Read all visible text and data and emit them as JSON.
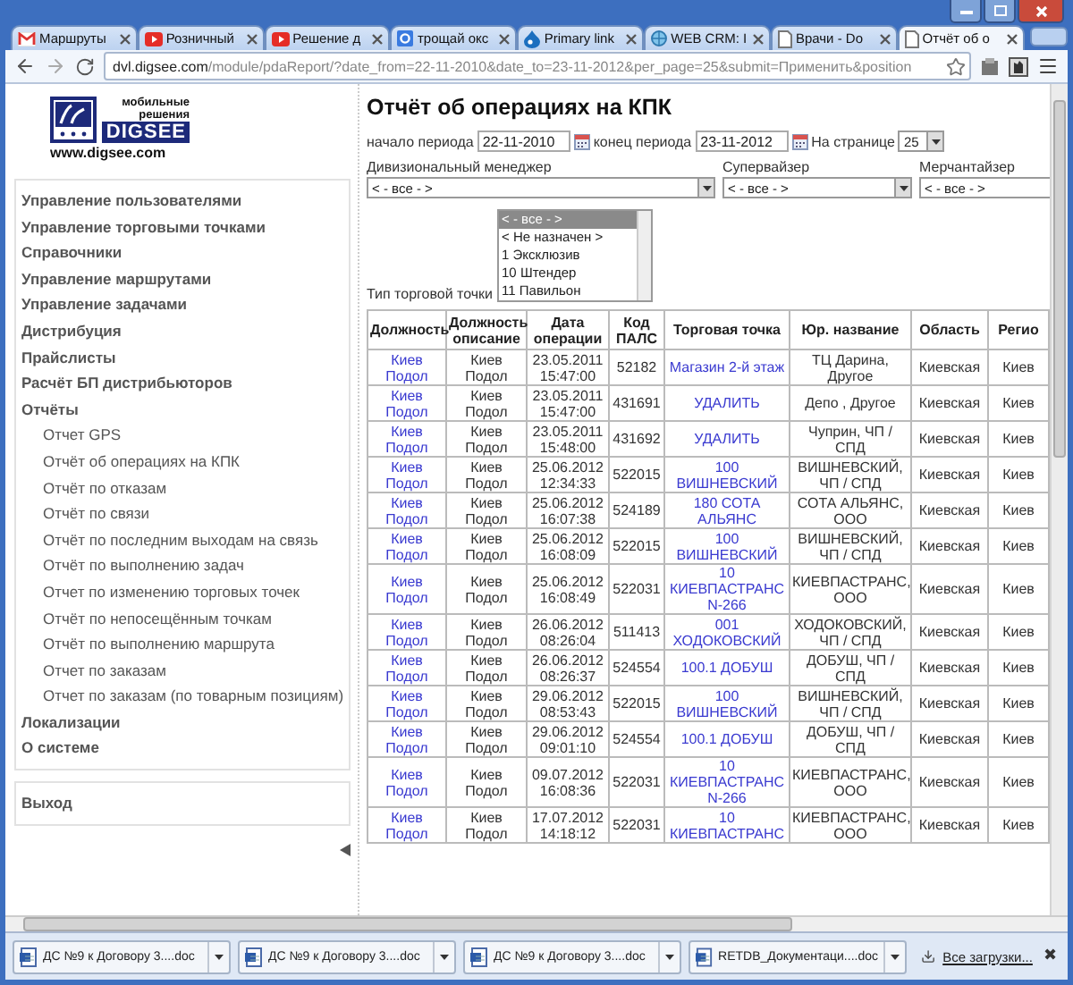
{
  "browser": {
    "tabs": [
      {
        "title": "Маршруты",
        "kind": "mail",
        "selected": false
      },
      {
        "title": "Розничный",
        "kind": "video",
        "selected": false
      },
      {
        "title": "Решение д",
        "kind": "video",
        "selected": false
      },
      {
        "title": "трощай окс",
        "kind": "tile",
        "selected": false
      },
      {
        "title": "Primary link",
        "kind": "drop",
        "selected": false
      },
      {
        "title": "WEB CRM: I",
        "kind": "globe",
        "selected": false
      },
      {
        "title": "Врачи - Do",
        "kind": "page",
        "selected": false
      },
      {
        "title": "Отчёт об о",
        "kind": "page",
        "selected": true
      }
    ],
    "address": {
      "host": "dvl.digsee.com",
      "path": "/module/pdaReport/?date_from=22-11-2010&date_to=23-11-2012&per_page=25&submit=Применить&position"
    }
  },
  "logo": {
    "tagline": "мобильные решения",
    "brand": "DIGSEE",
    "url": "www.digsee.com"
  },
  "menu": [
    {
      "label": "Управление пользователями"
    },
    {
      "label": "Управление торговыми точками"
    },
    {
      "label": "Справочники"
    },
    {
      "label": "Управление маршрутами"
    },
    {
      "label": "Управление задачами"
    },
    {
      "label": "Дистрибуция"
    },
    {
      "label": "Прайслисты"
    },
    {
      "label": "Расчёт БП дистрибьюторов"
    },
    {
      "label": "Отчёты",
      "children": [
        {
          "label": "Отчет GPS"
        },
        {
          "label": "Отчёт об операциях на КПК"
        },
        {
          "label": "Отчёт по отказам"
        },
        {
          "label": "Отчёт по связи"
        },
        {
          "label": "Отчёт по последним выходам на связь"
        },
        {
          "label": "Отчёт по выполнению задач"
        },
        {
          "label": "Отчет по изменению торговых точек"
        },
        {
          "label": "Отчёт по непосещённым точкам"
        },
        {
          "label": "Отчёт по выполнению маршрута"
        },
        {
          "label": "Отчет по заказам"
        },
        {
          "label": "Отчет по заказам (по товарным позициям)"
        }
      ]
    },
    {
      "label": "Локализации"
    },
    {
      "label": "О системе"
    }
  ],
  "logout": "Выход",
  "page_title": "Отчёт об операциях на КПК",
  "period": {
    "start_label": "начало периода",
    "start": "22-11-2010",
    "end_label": "конец периода",
    "end": "23-11-2012",
    "per_page_label": "На странице",
    "per_page": "25"
  },
  "filters": [
    {
      "label": "Дивизиональный менеджер",
      "value": "< - все - >"
    },
    {
      "label": "Супервайзер",
      "value": "< - все - >"
    },
    {
      "label": "Мерчантайзер",
      "value": "< - все - >"
    }
  ],
  "outlet_type": {
    "label": "Тип торговой точки",
    "options": [
      {
        "text": "< - все - >",
        "selected": true
      },
      {
        "text": "< Не назначен >",
        "selected": false
      },
      {
        "text": "1 Эксклюзив",
        "selected": false
      },
      {
        "text": "10 Штендер",
        "selected": false
      },
      {
        "text": "11 Павильон",
        "selected": false
      }
    ]
  },
  "table": {
    "columns": [
      {
        "label": "Должность",
        "link": true
      },
      {
        "label": "Должность описание",
        "link": false
      },
      {
        "label": "Дата операции",
        "link": false
      },
      {
        "label": "Код ПАЛС",
        "link": false
      },
      {
        "label": "Торговая точка",
        "link": true
      },
      {
        "label": "Юр. название",
        "link": false
      },
      {
        "label": "Область",
        "link": false
      },
      {
        "label": "Регио",
        "link": false
      }
    ],
    "rows": [
      [
        "Киев Подол",
        "Киев Подол",
        "23.05.2011 15:47:00",
        "52182",
        "Магазин 2-й этаж",
        "ТЦ Дарина, Другое",
        "Киевская",
        "Киев"
      ],
      [
        "Киев Подол",
        "Киев Подол",
        "23.05.2011 15:47:00",
        "431691",
        "УДАЛИТЬ",
        "Депо , Другое",
        "Киевская",
        "Киев"
      ],
      [
        "Киев Подол",
        "Киев Подол",
        "23.05.2011 15:48:00",
        "431692",
        "УДАЛИТЬ",
        "Чуприн, ЧП / СПД",
        "Киевская",
        "Киев"
      ],
      [
        "Киев Подол",
        "Киев Подол",
        "25.06.2012 12:34:33",
        "522015",
        "100 ВИШНЕВСКИЙ",
        "ВИШНЕВСКИЙ, ЧП / СПД",
        "Киевская",
        "Киев"
      ],
      [
        "Киев Подол",
        "Киев Подол",
        "25.06.2012 16:07:38",
        "524189",
        "180 СОТА АЛЬЯНС",
        "СОТА АЛЬЯНС, ООО",
        "Киевская",
        "Киев"
      ],
      [
        "Киев Подол",
        "Киев Подол",
        "25.06.2012 16:08:09",
        "522015",
        "100 ВИШНЕВСКИЙ",
        "ВИШНЕВСКИЙ, ЧП / СПД",
        "Киевская",
        "Киев"
      ],
      [
        "Киев Подол",
        "Киев Подол",
        "25.06.2012 16:08:49",
        "522031",
        "10 КИЕВПАСТРАНС N-266",
        "КИЕВПАСТРАНС, ООО",
        "Киевская",
        "Киев"
      ],
      [
        "Киев Подол",
        "Киев Подол",
        "26.06.2012 08:26:04",
        "511413",
        "001 ХОДОКОВСКИЙ",
        "ХОДОКОВСКИЙ, ЧП / СПД",
        "Киевская",
        "Киев"
      ],
      [
        "Киев Подол",
        "Киев Подол",
        "26.06.2012 08:26:37",
        "524554",
        "100.1 ДОБУШ",
        "ДОБУШ, ЧП / СПД",
        "Киевская",
        "Киев"
      ],
      [
        "Киев Подол",
        "Киев Подол",
        "29.06.2012 08:53:43",
        "522015",
        "100 ВИШНЕВСКИЙ",
        "ВИШНЕВСКИЙ, ЧП / СПД",
        "Киевская",
        "Киев"
      ],
      [
        "Киев Подол",
        "Киев Подол",
        "29.06.2012 09:01:10",
        "524554",
        "100.1 ДОБУШ",
        "ДОБУШ, ЧП / СПД",
        "Киевская",
        "Киев"
      ],
      [
        "Киев Подол",
        "Киев Подол",
        "09.07.2012 16:08:36",
        "522031",
        "10 КИЕВПАСТРАНС N-266",
        "КИЕВПАСТРАНС, ООО",
        "Киевская",
        "Киев"
      ],
      [
        "Киев Подол",
        "Киев Подол",
        "17.07.2012 14:18:12",
        "522031",
        "10 КИЕВПАСТРАНС",
        "КИЕВПАСТРАНС, ООО",
        "Киевская",
        "Киев"
      ]
    ]
  },
  "downloads": {
    "items": [
      "ДС №9 к Договору 3....doc",
      "ДС №9 к Договору 3....doc",
      "ДС №9 к Договору 3....doc",
      "RETDB_Документаци....doc"
    ],
    "all": "Все загрузки...",
    "close": "✖"
  }
}
